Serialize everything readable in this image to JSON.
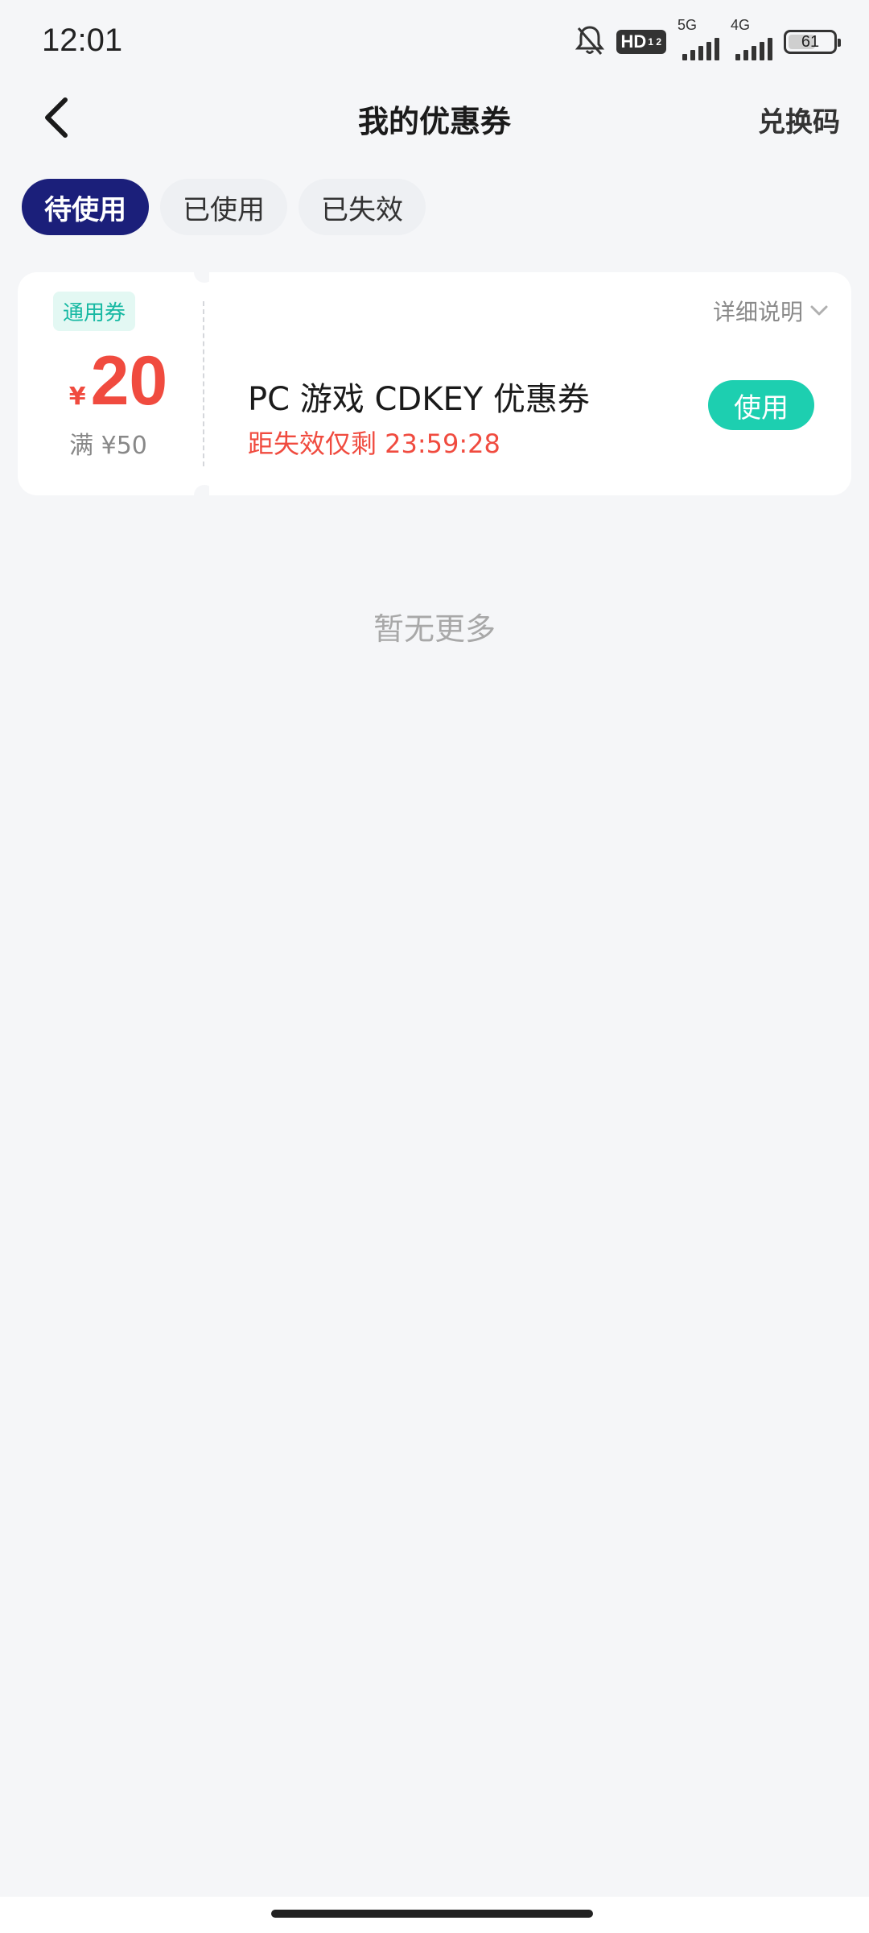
{
  "status_bar": {
    "time": "12:01",
    "hd_label": "HD",
    "hd_sub": "1 2",
    "net1_label": "5G",
    "net2_label": "4G",
    "battery_level": 61,
    "battery_text": "61"
  },
  "header": {
    "title": "我的优惠券",
    "redeem_label": "兑换码",
    "back_icon": "chevron-left-icon"
  },
  "tabs": [
    {
      "label": "待使用",
      "active": true
    },
    {
      "label": "已使用",
      "active": false
    },
    {
      "label": "已失效",
      "active": false
    }
  ],
  "coupon": {
    "type_badge": "通用券",
    "currency": "¥",
    "amount": "20",
    "threshold": "满 ¥50",
    "detail_label": "详细说明",
    "title": "PC 游戏 CDKEY 优惠券",
    "countdown": "距失效仅剩 23:59:28",
    "use_label": "使用"
  },
  "footer_text": "暂无更多",
  "colors": {
    "active_tab": "#1b1f7a",
    "accent_red": "#f04b3f",
    "use_button": "#1dcfb0",
    "badge_text": "#17b9a3"
  }
}
